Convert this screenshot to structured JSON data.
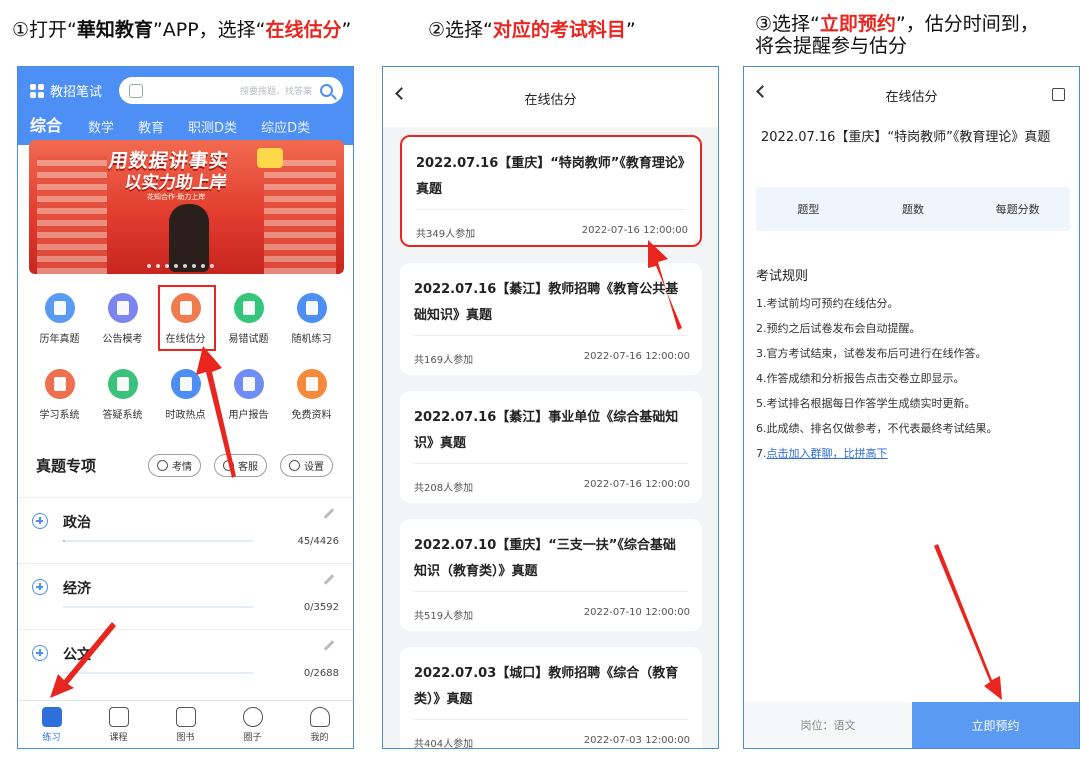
{
  "captions": {
    "step1": {
      "prefix": "①打开“",
      "app": "華知教育",
      "mid": "”APP，选择“",
      "target": "在线估分",
      "suffix": "”"
    },
    "step2": {
      "prefix": "②选择“",
      "target": "对应的考试科目",
      "suffix": "”"
    },
    "step3": {
      "prefix": "③选择“",
      "target": "立即预约",
      "suffix": "”，估分时间到，",
      "line2": "将会提醒参与估分"
    }
  },
  "phone1": {
    "logo": "教招笔试",
    "search_placeholder": "搜要搜题、找答案",
    "tabs": [
      "综合",
      "数学",
      "教育",
      "职测D类",
      "综应D类"
    ],
    "banner": {
      "line1": "用数据讲事实",
      "line2": "以实力助上岸",
      "sub": "花知合作·助力上岸"
    },
    "grid_row1": [
      {
        "label": "历年真题",
        "color": "#5b9af2"
      },
      {
        "label": "公告模考",
        "color": "#7c84f0"
      },
      {
        "label": "在线估分",
        "color": "#f07b4e"
      },
      {
        "label": "易错试题",
        "color": "#34c67a"
      },
      {
        "label": "随机练习",
        "color": "#4e8ff5"
      }
    ],
    "grid_row2": [
      {
        "label": "学习系统",
        "color": "#f0704e"
      },
      {
        "label": "答疑系统",
        "color": "#3ac27a"
      },
      {
        "label": "时政热点",
        "color": "#4e8ff5"
      },
      {
        "label": "用户报告",
        "color": "#6f8df5"
      },
      {
        "label": "免费资料",
        "color": "#f58a3c"
      }
    ],
    "section_title": "真题专项",
    "pills": [
      "考情",
      "客服",
      "设置"
    ],
    "subjects": [
      {
        "name": "政治",
        "count": "45/4426",
        "progress": 0.01
      },
      {
        "name": "经济",
        "count": "0/3592",
        "progress": 0
      },
      {
        "name": "公文",
        "count": "0/2688",
        "progress": 0
      }
    ],
    "nav": [
      {
        "label": "练习",
        "active": true
      },
      {
        "label": "课程",
        "active": false
      },
      {
        "label": "图书",
        "active": false
      },
      {
        "label": "圈子",
        "active": false
      },
      {
        "label": "我的",
        "active": false
      }
    ]
  },
  "phone2": {
    "title": "在线估分",
    "cards": [
      {
        "title": "2022.07.16【重庆】“特岗教师”《教育理论》真题",
        "joined": "共349人参加",
        "time": "2022-07-16 12:00:00"
      },
      {
        "title": "2022.07.16【綦江】教师招聘《教育公共基础知识》真题",
        "joined": "共169人参加",
        "time": "2022-07-16 12:00:00"
      },
      {
        "title": "2022.07.16【綦江】事业单位《综合基础知识》真题",
        "joined": "共208人参加",
        "time": "2022-07-16 12:00:00"
      },
      {
        "title": "2022.07.10【重庆】“三支一扶”《综合基础知识（教育类）》真题",
        "joined": "共519人参加",
        "time": "2022-07-10 12:00:00"
      },
      {
        "title": "2022.07.03【城口】教师招聘《综合（教育类）》真题",
        "joined": "共404人参加",
        "time": "2022-07-03 12:00:00"
      }
    ]
  },
  "phone3": {
    "title": "在线估分",
    "exam_title": "2022.07.16【重庆】“特岗教师”《教育理论》真题",
    "table_headers": [
      "题型",
      "题数",
      "每题分数"
    ],
    "rules_title": "考试规则",
    "rules": [
      "1.考试前均可预约在线估分。",
      "2.预约之后试卷发布会自动提醒。",
      "3.官方考试结束，试卷发布后可进行在线作答。",
      "4.作答成绩和分析报告点击交卷立即显示。",
      "5.考试排名根据每日作答学生成绩实时更新。",
      "6.此成绩、排名仅做参考，不代表最终考试结果。"
    ],
    "rule7_prefix": "7.",
    "rule7_link": "点击加入群聊，比拼高下",
    "position_label": "岗位：语文",
    "reserve_button": "立即预约"
  }
}
